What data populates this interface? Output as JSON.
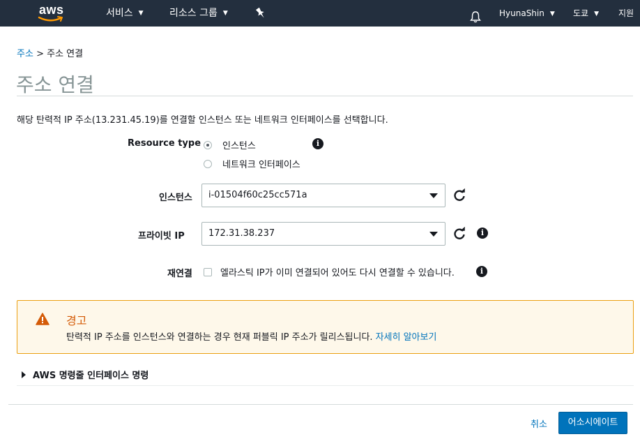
{
  "topnav": {
    "logo_text": "aws",
    "services_label": "서비스",
    "resource_groups_label": "리소스 그룹",
    "user_label": "HyunaShin",
    "region_label": "도쿄",
    "support_label": "지원",
    "icons": [
      "aws-logo",
      "chevron-down-icon",
      "pin-icon",
      "bell-icon"
    ]
  },
  "breadcrumb": {
    "parent": "주소",
    "separator": ">",
    "current": "주소 연결"
  },
  "page_title": "주소 연결",
  "description": "해당 탄력적 IP 주소(13.231.45.19)를 연결할 인스턴스 또는 네트워크 인터페이스를 선택합니다.",
  "form": {
    "resource_type": {
      "label": "Resource type",
      "options": [
        {
          "label": "인스턴스",
          "selected": true
        },
        {
          "label": "네트워크 인터페이스",
          "selected": false
        }
      ]
    },
    "instance": {
      "label": "인스턴스",
      "value": "i-01504f60c25cc571a"
    },
    "private_ip": {
      "label": "프라이빗 IP",
      "value": "172.31.38.237"
    },
    "reassociation": {
      "label": "재연결",
      "checkbox_label": "엘라스틱 IP가 이미 연결되어 있어도 다시 연결할 수 있습니다.",
      "checked": false
    }
  },
  "warning": {
    "title": "경고",
    "text": "탄력적 IP 주소를 인스턴스와 연결하는 경우 현재 퍼블릭 IP 주소가 릴리스됩니다.",
    "link": "자세히 알아보기"
  },
  "cli_expander": {
    "label": "AWS 명령줄 인터페이스 명령",
    "expanded": false
  },
  "footer": {
    "cancel_label": "취소",
    "associate_label": "어소시에이트"
  },
  "colors": {
    "nav_bg": "#232f3e",
    "link": "#0073bb",
    "primary": "#0073bb",
    "warning_border": "#eb9f10",
    "warning_title": "#d45b07",
    "aws_orange": "#ff9900"
  }
}
